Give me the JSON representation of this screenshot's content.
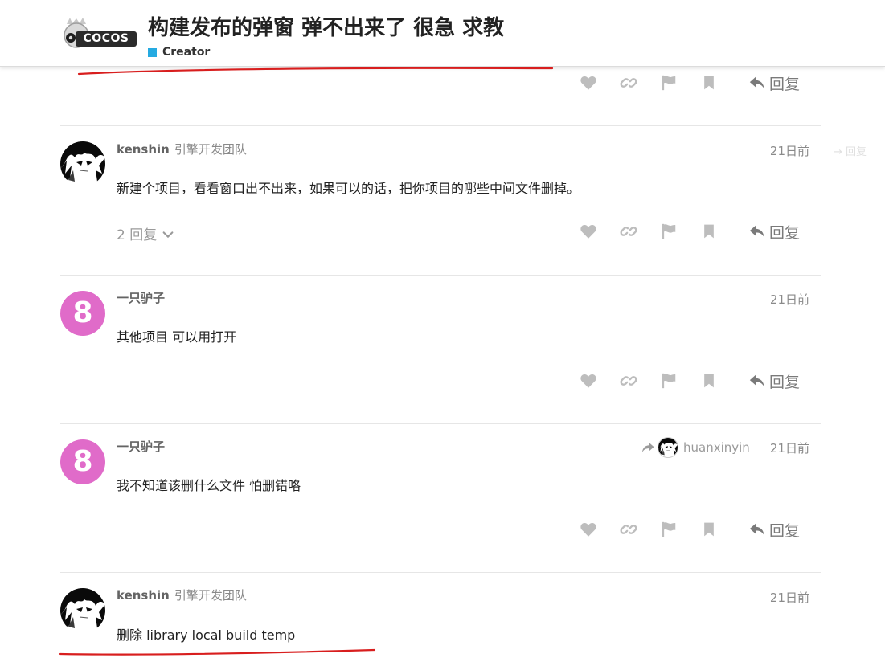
{
  "header": {
    "logo_text": "COCOS",
    "title": "构建发布的弹窗 弹不出来了 很急 求教",
    "category": {
      "label": "Creator",
      "color": "#25aae1"
    }
  },
  "actions": {
    "like_icon": "heart-icon",
    "link_icon": "link-icon",
    "flag_icon": "flag-icon",
    "bookmark_icon": "bookmark-icon",
    "reply_label": "回复"
  },
  "posts": [
    {
      "author": "kenshin",
      "user_title": "引擎开发团队",
      "date": "21日前",
      "text": "新建个项目，看看窗口出不出来，如果可以的话，把你项目的哪些中间文件删掉。",
      "replies_toggle": "2 回复",
      "right_gutter": "→ 回复"
    },
    {
      "author": "一只驴子",
      "avatar_letter": "8",
      "date": "21日前",
      "text": "其他项目 可以用打开"
    },
    {
      "author": "一只驴子",
      "avatar_letter": "8",
      "date": "21日前",
      "reply_to": "huanxinyin",
      "text": "我不知道该删什么文件 怕删错咯"
    },
    {
      "author": "kenshin",
      "user_title": "引擎开发团队",
      "date": "21日前",
      "text": "删除 library local build temp"
    }
  ],
  "colors": {
    "accent_pink_avatar": "#e06bc9",
    "annotation_red": "#d81e1e",
    "category_blue": "#25aae1"
  }
}
